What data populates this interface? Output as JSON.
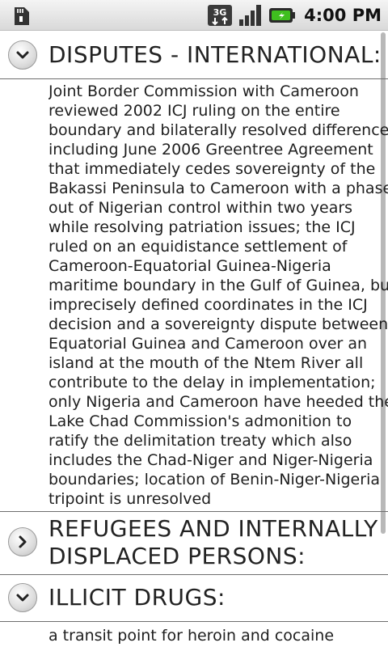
{
  "status_bar": {
    "network_type": "3G",
    "time": "4:00 PM",
    "icons": [
      "sd-card-icon",
      "network-3g-icon",
      "signal-strength-icon",
      "battery-charging-icon"
    ]
  },
  "sections": {
    "disputes": {
      "title": "DISPUTES - INTERNATIONAL:",
      "lines": [
        "Joint Border Commission with Cameroon",
        "reviewed 2002 ICJ ruling on the entire",
        "boundary and bilaterally resolved differences,",
        "including June 2006 Greentree Agreement",
        "that immediately cedes sovereignty of the",
        "Bakassi Peninsula to Cameroon with a phase-",
        "out of Nigerian control within two years",
        "while resolving patriation issues; the ICJ",
        "ruled on an equidistance settlement of",
        "Cameroon-Equatorial Guinea-Nigeria",
        "maritime boundary in the Gulf of Guinea, but",
        "imprecisely defined coordinates in the ICJ",
        "decision and a sovereignty dispute between",
        "Equatorial Guinea and Cameroon over an",
        "island at the mouth of the Ntem River all",
        "contribute to the delay in implementation;",
        "only Nigeria and Cameroon have heeded the",
        "Lake Chad Commission's admonition to",
        "ratify the delimitation treaty which also",
        "includes the Chad-Niger and Niger-Nigeria",
        "boundaries; location of Benin-Niger-Nigeria",
        "tripoint is unresolved"
      ]
    },
    "refugees": {
      "title": "REFUGEES AND INTERNALLY\nDISPLACED PERSONS:"
    },
    "drugs": {
      "title": "ILLICIT DRUGS:",
      "text": "a transit point for heroin and cocaine"
    }
  },
  "colors": {
    "divider": "#6e6e6e",
    "status_bar": "#e0e0e0",
    "battery_accent": "#3fbf1f"
  }
}
